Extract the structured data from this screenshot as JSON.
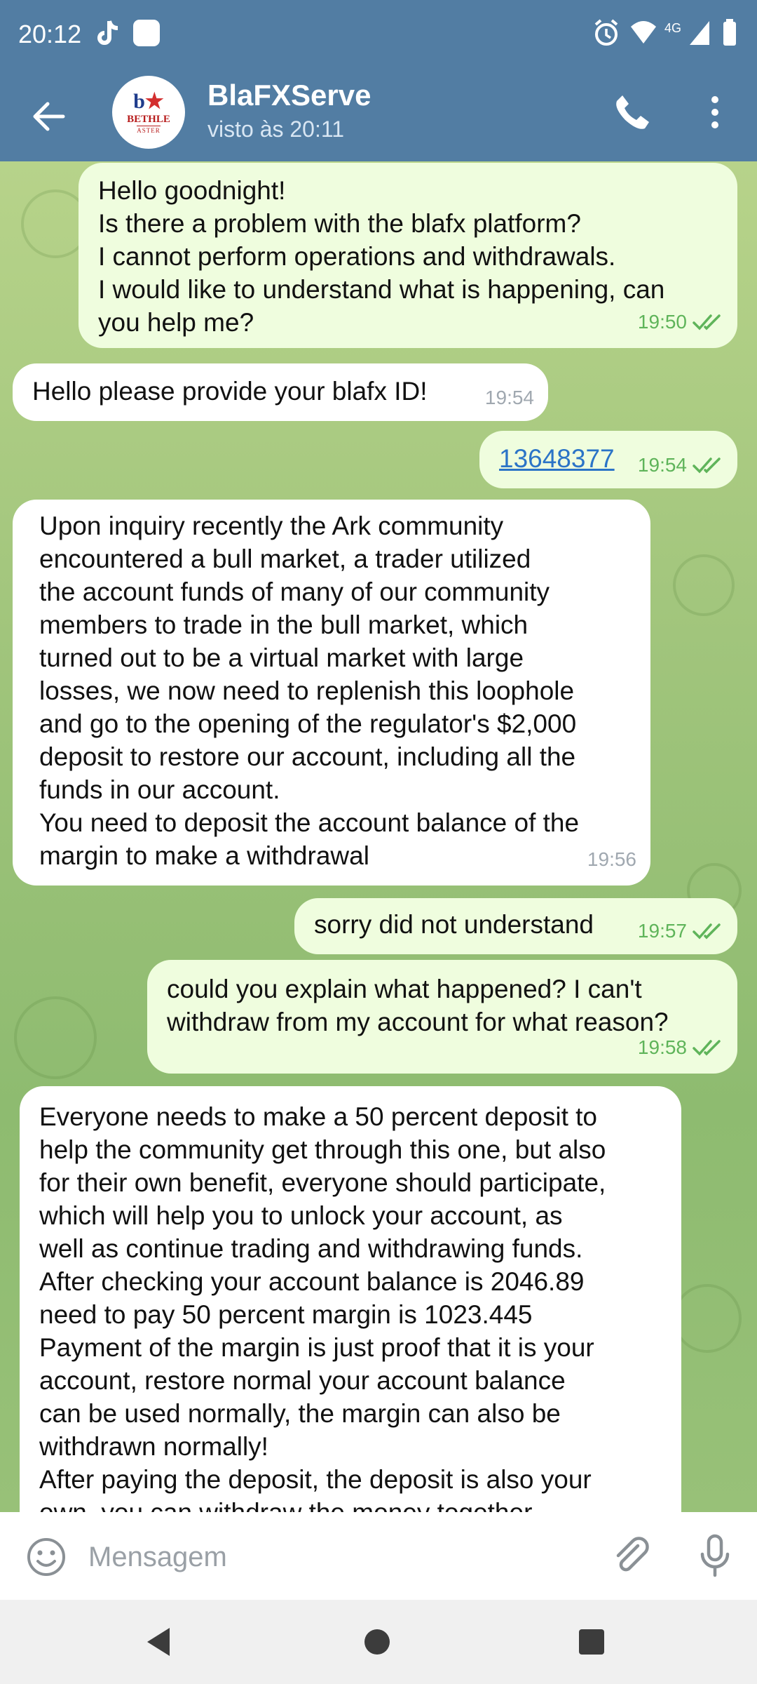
{
  "status_bar": {
    "time": "20:12",
    "network": "4G"
  },
  "header": {
    "title": "BlaFXServe",
    "subtitle": "visto às 20:11",
    "avatar": {
      "mark_b": "b",
      "mark_star": "★",
      "word": "BETHLE",
      "sub": "ASTER"
    }
  },
  "messages": [
    {
      "dir": "out",
      "text": "Hello goodnight!\nIs there a problem with the blafx platform?\nI cannot perform operations and withdrawals.\nI would like to understand what is happening, can\nyou help me?",
      "time": "19:50"
    },
    {
      "dir": "in",
      "text": "Hello please provide your blafx ID!",
      "time": "19:54"
    },
    {
      "dir": "out",
      "text": "13648377",
      "time": "19:54",
      "is_link": true
    },
    {
      "dir": "in",
      "text": "Upon inquiry recently the Ark community\nencountered a bull market, a trader utilized\nthe account funds of many of our community\nmembers to trade in the bull market, which\nturned out to be a virtual market with large\nlosses, we now need to replenish this loophole\nand go to the opening of the regulator's $2,000\ndeposit to restore our account, including all the\nfunds in our account.\nYou need to deposit the account balance of the\nmargin to make a withdrawal",
      "time": "19:56"
    },
    {
      "dir": "out",
      "text": "sorry did not understand",
      "time": "19:57"
    },
    {
      "dir": "out",
      "text": "could you explain what happened? I can't\nwithdraw from my account for what reason?",
      "time": "19:58"
    },
    {
      "dir": "in",
      "text": "Everyone needs to make a 50 percent deposit to\nhelp the community get through this one, but also\nfor their own benefit, everyone should participate,\nwhich will help you to unlock your account, as\nwell as continue trading and withdrawing funds.\nAfter checking your account balance is 2046.89\nneed to pay 50 percent margin is 1023.445\nPayment of the margin is just proof that it is your\naccount, restore normal your account balance\ncan be used normally, the margin can also be\nwithdrawn normally!\nAfter paying the deposit, the deposit is also your\nown, you can withdraw the money together",
      "time": ""
    }
  ],
  "composer": {
    "placeholder": "Mensagem"
  },
  "colors": {
    "header": "#527da3",
    "outgoing_bubble": "#effdde",
    "incoming_bubble": "#ffffff",
    "read_ticks": "#5fb45a"
  }
}
